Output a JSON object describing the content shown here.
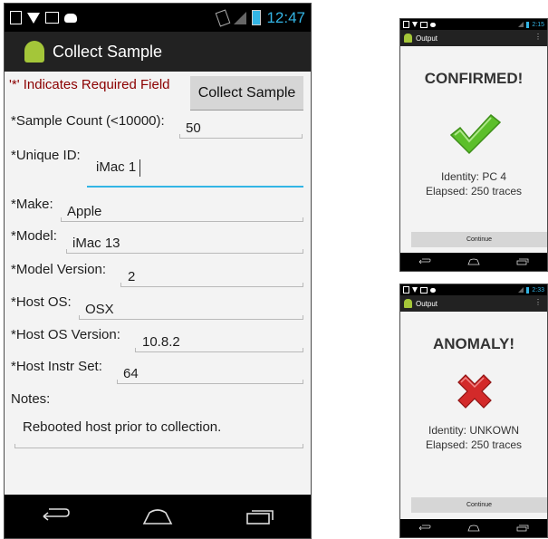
{
  "main_phone": {
    "status_time": "12:47",
    "app_title": "Collect Sample",
    "required_note": "'*' Indicates Required Field",
    "collect_button": "Collect Sample",
    "fields": {
      "sample_count": {
        "label": "*Sample Count (<10000):",
        "value": "50"
      },
      "unique_id": {
        "label": "*Unique ID:",
        "value": "iMac 1"
      },
      "make": {
        "label": "*Make:",
        "value": "Apple"
      },
      "model": {
        "label": "*Model:",
        "value": "iMac 13"
      },
      "model_version": {
        "label": "*Model Version:",
        "value": "2"
      },
      "host_os": {
        "label": "*Host OS:",
        "value": "OSX"
      },
      "host_os_version": {
        "label": "*Host OS Version:",
        "value": "10.8.2"
      },
      "host_instr_set": {
        "label": "*Host Instr Set:",
        "value": "64"
      },
      "notes": {
        "label": "Notes:",
        "value": "Rebooted host prior to collection."
      }
    },
    "colors": {
      "required_note": "#8b0000",
      "accent": "#33b5e5"
    }
  },
  "confirmed_phone": {
    "status_time": "2:15",
    "app_title": "Output",
    "result_title": "CONFIRMED!",
    "result_icon": "green-check-icon",
    "identity": "Identity: PC 4",
    "elapsed": "Elapsed: 250 traces",
    "continue_button": "Continue"
  },
  "anomaly_phone": {
    "status_time": "2:33",
    "app_title": "Output",
    "result_title": "ANOMALY!",
    "result_icon": "red-x-icon",
    "identity": "Identity: UNKOWN",
    "elapsed": "Elapsed: 250 traces",
    "continue_button": "Continue"
  }
}
